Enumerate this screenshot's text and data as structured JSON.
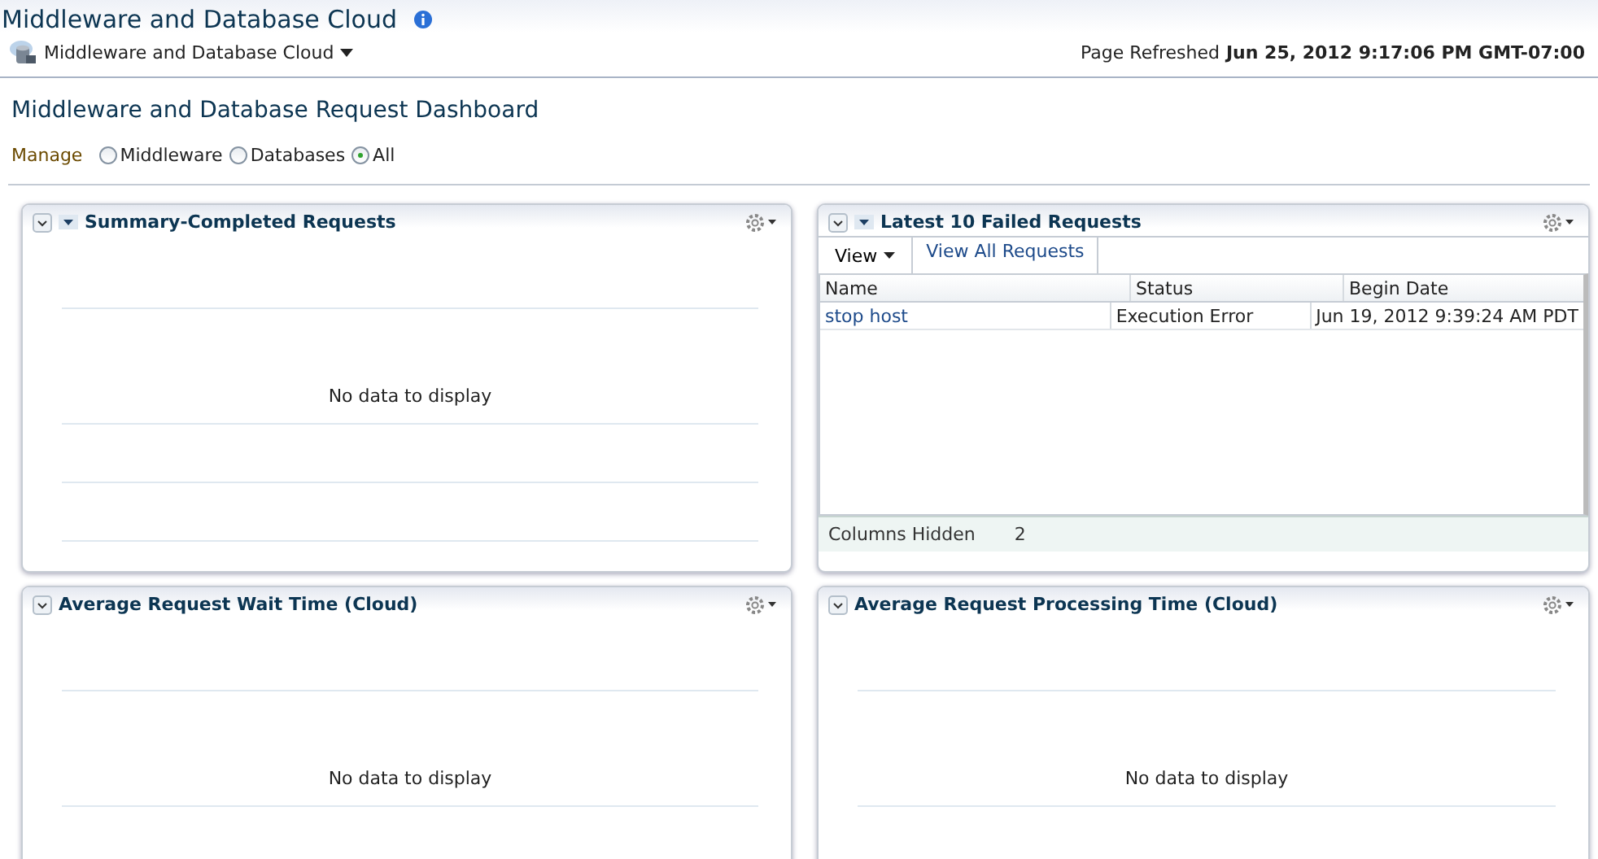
{
  "page_title": "Middleware and Database Cloud",
  "target_menu": {
    "label": "Middleware and Database Cloud"
  },
  "refreshed": {
    "label": "Page Refreshed",
    "value": "Jun 25, 2012 9:17:06 PM GMT-07:00"
  },
  "dashboard_title": "Middleware and Database Request Dashboard",
  "manage": {
    "label": "Manage",
    "options": [
      {
        "label": "Middleware",
        "selected": false
      },
      {
        "label": "Databases",
        "selected": false
      },
      {
        "label": "All",
        "selected": true
      }
    ]
  },
  "panels": [
    {
      "kind": "empty",
      "title": "Summary-Completed Requests",
      "menu": true,
      "message": "No data to display"
    },
    {
      "kind": "table",
      "title": "Latest 10 Failed Requests",
      "menu": true,
      "toolbar": {
        "view": "View",
        "link": "View All Requests"
      },
      "columns": [
        "Name",
        "Status",
        "Begin Date"
      ],
      "rows": [
        {
          "name": "stop host",
          "status": "Execution Error",
          "begin_date": "Jun 19, 2012 9:39:24 AM PDT"
        }
      ],
      "footer": {
        "label": "Columns Hidden",
        "value": "2"
      }
    },
    {
      "kind": "empty",
      "title": "Average Request Wait Time (Cloud)",
      "menu": false,
      "message": "No data to display"
    },
    {
      "kind": "empty",
      "title": "Average Request Processing Time (Cloud)",
      "menu": false,
      "message": "No data to display"
    }
  ]
}
